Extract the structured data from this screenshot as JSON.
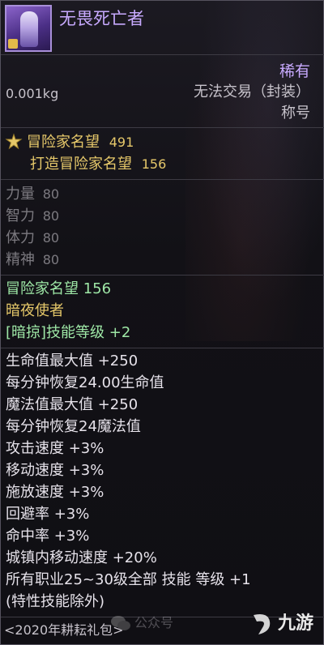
{
  "item": {
    "name": "无畏死亡者",
    "icon": "avatar-item-icon"
  },
  "info": {
    "rarity": "稀有",
    "weight": "0.001kg",
    "trade": "无法交易（封装）",
    "type": "称号"
  },
  "reputation": {
    "adventurer_label": "冒险家名望",
    "adventurer_value": "491",
    "crafted_label": "打造冒险家名望",
    "crafted_value": "156"
  },
  "base_stats": [
    {
      "label": "力量",
      "value": "80"
    },
    {
      "label": "智力",
      "value": "80"
    },
    {
      "label": "体力",
      "value": "80"
    },
    {
      "label": "精神",
      "value": "80"
    }
  ],
  "green_block": {
    "reputation": "冒险家名望 156",
    "class_name": "暗夜使者",
    "skill_level": "[暗掠]技能等级 +2"
  },
  "effects": [
    "生命值最大值 +250",
    "每分钟恢复24.00生命值",
    "魔法值最大值 +250",
    "每分钟恢复24魔法值",
    "攻击速度 +3%",
    "移动速度 +3%",
    "施放速度 +3%",
    "回避率 +3%",
    "命中率 +3%",
    "城镇内移动速度 +20%",
    "所有职业25~30级全部 技能 等级 +1",
    "(特性技能除外)"
  ],
  "footer": {
    "source": "<2020年耕耘礼包>",
    "watermark": "公众号",
    "logo": "九游"
  },
  "colors": {
    "title_purple": "#c8aaff",
    "gold": "#e6c86a",
    "green": "#9ee7a6",
    "white": "#e6e2ea",
    "grey": "#7c7a80"
  }
}
